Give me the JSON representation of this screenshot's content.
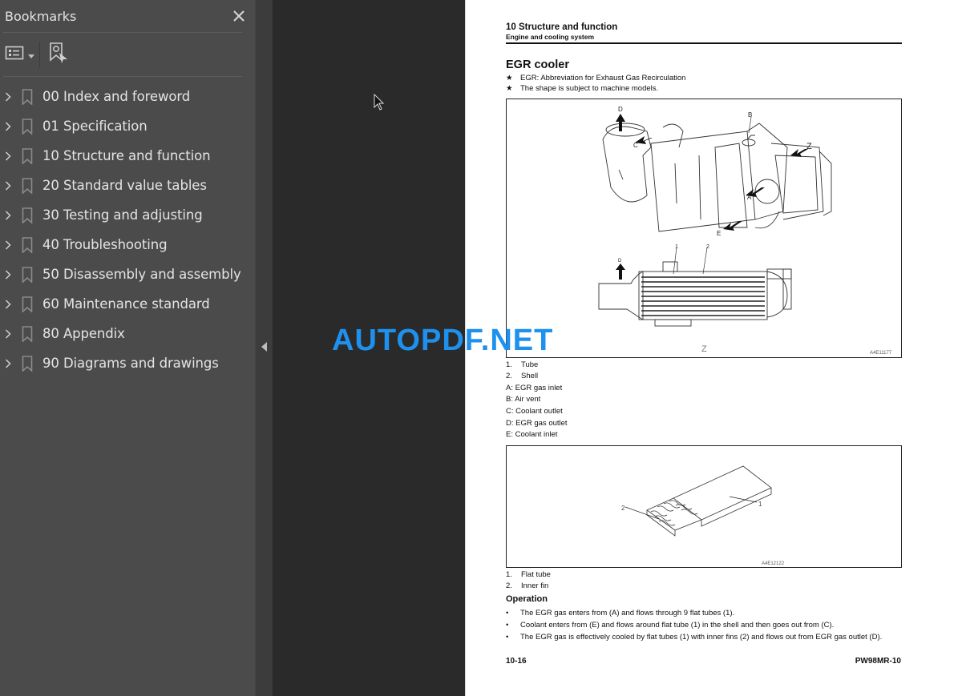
{
  "sidebar": {
    "title": "Bookmarks",
    "close_icon": "close-icon",
    "toolbar": {
      "options_icon": "list-options-icon",
      "find_bookmark_icon": "find-current-bookmark-icon"
    },
    "items": [
      {
        "label": "00 Index and foreword"
      },
      {
        "label": "01 Specification"
      },
      {
        "label": "10 Structure and function"
      },
      {
        "label": "20 Standard value tables"
      },
      {
        "label": "30 Testing and adjusting"
      },
      {
        "label": "40 Troubleshooting"
      },
      {
        "label": "50 Disassembly and assembly"
      },
      {
        "label": "60 Maintenance standard"
      },
      {
        "label": "80 Appendix"
      },
      {
        "label": "90 Diagrams and drawings"
      }
    ]
  },
  "collapse_icon": "collapse-left-icon",
  "watermark": "AUTOPDF.NET",
  "page": {
    "header_title": "10 Structure and function",
    "header_subtitle": "Engine and cooling system",
    "section_title": "EGR cooler",
    "notes": [
      {
        "symbol": "★",
        "text": "EGR: Abbreviation for Exhaust Gas Recirculation"
      },
      {
        "symbol": "★",
        "text": "The shape is subject to machine models."
      }
    ],
    "figure1": {
      "labels": {
        "a": "A",
        "b": "B",
        "c": "C",
        "d": "D",
        "e": "E",
        "z": "Z",
        "d2": "D",
        "n1": "1",
        "n2": "2",
        "z_view": "Z"
      },
      "code": "A4E11177"
    },
    "figure1_captions": [
      {
        "num": "1.",
        "text": "Tube"
      },
      {
        "num": "2.",
        "text": "Shell"
      },
      {
        "num": "A:",
        "text": "EGR gas inlet"
      },
      {
        "num": "B:",
        "text": "Air vent"
      },
      {
        "num": "C:",
        "text": "Coolant outlet"
      },
      {
        "num": "D:",
        "text": "EGR gas outlet"
      },
      {
        "num": "E:",
        "text": "Coolant inlet"
      }
    ],
    "figure2": {
      "labels": {
        "n1": "1",
        "n2": "2"
      },
      "code": "A4E12122"
    },
    "figure2_captions": [
      {
        "num": "1.",
        "text": "Flat tube"
      },
      {
        "num": "2.",
        "text": "Inner fin"
      }
    ],
    "operation_title": "Operation",
    "operation_items": [
      "The EGR gas enters from (A) and flows through 9 flat tubes (1).",
      "Coolant enters from (E) and flows around flat tube (1) in the shell and then goes out from (C).",
      "The EGR gas is effectively cooled by flat tubes (1) with inner fins (2) and flows out from EGR gas outlet  (D)."
    ],
    "bullet": "•",
    "footer_page": "10-16",
    "footer_model": "PW98MR-10"
  }
}
